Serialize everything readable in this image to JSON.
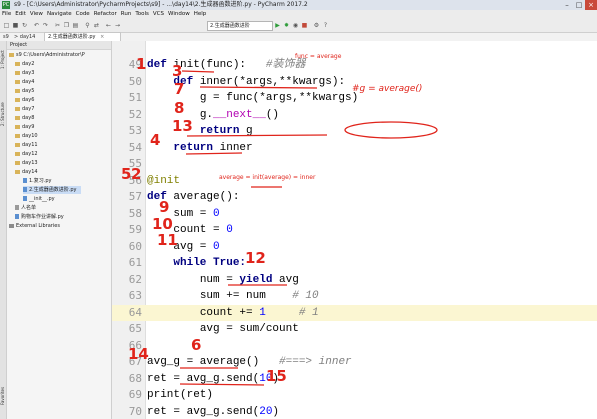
{
  "window": {
    "title": "s9 - [C:\\Users\\Administrator\\PycharmProjects\\s9] - ...\\day14\\2.生成器函数进阶.py - PyCharm 2017.2",
    "controls": [
      "–",
      "□",
      "×"
    ]
  },
  "menu": [
    "File",
    "Edit",
    "View",
    "Navigate",
    "Code",
    "Refactor",
    "Run",
    "Tools",
    "VCS",
    "Window",
    "Help"
  ],
  "toolbar": {
    "run_config": "2.生成器函数进阶"
  },
  "nav": {
    "crumbs": [
      "s9",
      "day14",
      "2.生成器函数进阶.py"
    ]
  },
  "tab": {
    "label": "2.生成器函数进阶.py"
  },
  "sidebar_tabs": [
    "1: Project",
    "2: Structure",
    "Favorites"
  ],
  "project": {
    "header": "Project",
    "root": "s9  C:\\Users\\Administrator\\P",
    "items": [
      "day2",
      "day3",
      "day4",
      "day5",
      "day6",
      "day7",
      "day8",
      "day9",
      "day10",
      "day11",
      "day12",
      "day13",
      "day14"
    ],
    "day14_children": [
      "1.复习.py",
      "2.生成器函数进阶.py",
      "__init__.py"
    ],
    "others": [
      "人名单",
      "购物车作业讲解.py"
    ],
    "external": "External Libraries"
  },
  "code": {
    "line_numbers": [
      "49",
      "50",
      "51",
      "52",
      "53",
      "54",
      "55",
      "56",
      "57",
      "58",
      "59",
      "60",
      "61",
      "62",
      "63",
      "64",
      "65",
      "66",
      "67",
      "68",
      "69",
      "70"
    ],
    "l49_kw": "def",
    "l49_name": "init",
    "l49_rest": "(func):",
    "l49_cm": "#装饰器",
    "l50_kw": "def",
    "l50_rest": "inner(*args,**kwargs):",
    "l51": "g = func(*args,**kwargs)",
    "l52_a": "g.",
    "l52_b": "__next__",
    "l52_c": "()",
    "l53_kw": "return",
    "l53_rest": "g",
    "l54_kw": "return",
    "l54_rest": "inner",
    "l56": "@init",
    "l57_kw": "def",
    "l57_rest": "average():",
    "l58_a": "sum = ",
    "l58_b": "0",
    "l59_a": "count = ",
    "l59_b": "0",
    "l60_a": "avg = ",
    "l60_b": "0",
    "l61_kw": "while True:",
    "l62_a": "num = ",
    "l62_kw": "yield",
    "l62_b": "avg",
    "l63_a": "sum += num",
    "l63_cm": "# 10",
    "l64_a": "count += ",
    "l64_b": "1",
    "l64_cm": "# 1",
    "l65": "avg = sum/count",
    "l67_a": "avg_g = average()",
    "l67_cm": "#===> inner",
    "l68_a": "ret = avg_g.send(",
    "l68_b": "10",
    "l68_c": ")",
    "l69": "print(ret)",
    "l70_a": "ret = avg_g.send(",
    "l70_b": "20",
    "l70_c": ")"
  },
  "annotations": {
    "n1": "1",
    "n2": "2",
    "n3": "3",
    "n4": "4",
    "n5": "5",
    "n6": "6",
    "n7": "7",
    "n8": "8",
    "n9": "9",
    "n10": "10",
    "n11": "11",
    "n12": "12",
    "n13": "13",
    "n14": "14",
    "n15": "15",
    "note_func": "func = average",
    "note_g": "#g = average()",
    "note_init": "average = init(average) = inner",
    "color": "#e0241b"
  }
}
